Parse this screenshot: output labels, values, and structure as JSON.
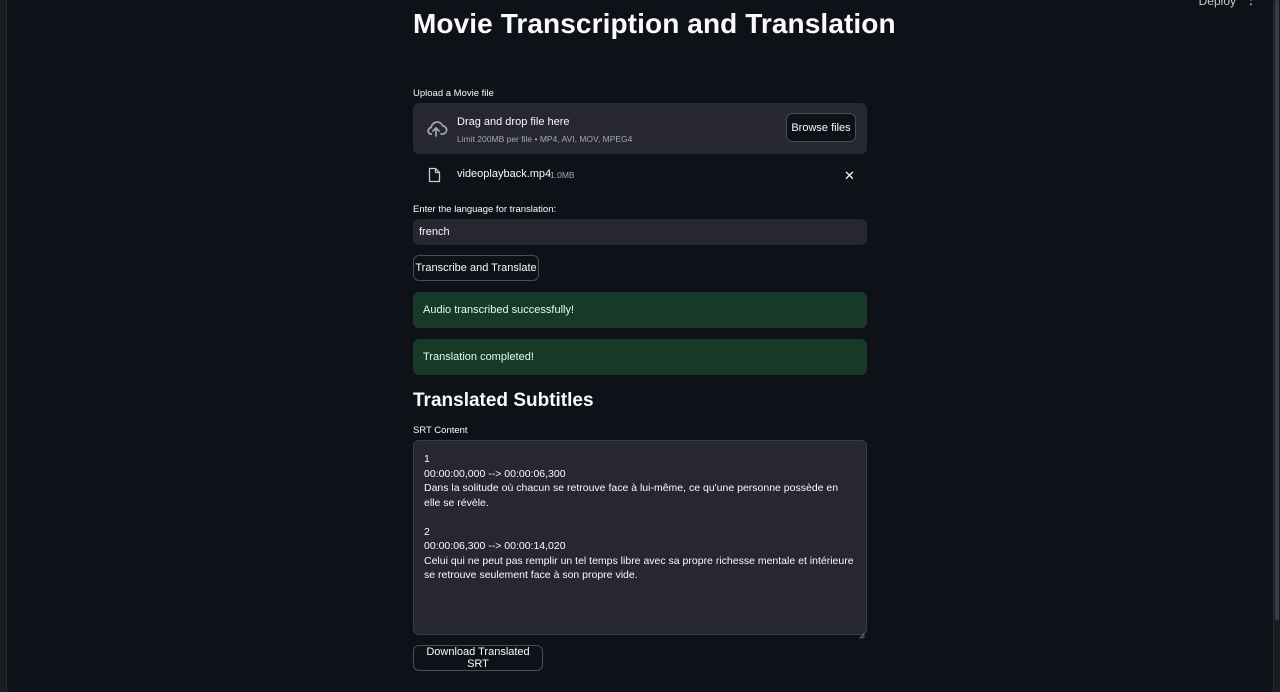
{
  "topbar": {
    "deploy_label": "Deploy",
    "menu_icon": "⋮"
  },
  "page": {
    "title": "Movie Transcription and Translation"
  },
  "upload": {
    "label": "Upload a Movie file",
    "dropzone_title": "Drag and drop file here",
    "dropzone_subtitle": "Limit 200MB per file • MP4, AVI, MOV, MPEG4",
    "browse_label": "Browse files",
    "icon": "cloud-upload-icon"
  },
  "uploaded_file": {
    "name": "videoplayback.mp4",
    "size": "1.0MB",
    "icon": "file-icon",
    "remove_glyph": "✕"
  },
  "language": {
    "label": "Enter the language for translation:",
    "value": "french"
  },
  "actions": {
    "transcribe_label": "Transcribe and Translate",
    "download_label": "Download Translated SRT"
  },
  "alerts": [
    "Audio transcribed successfully!",
    "Translation completed!"
  ],
  "subtitles": {
    "heading": "Translated Subtitles",
    "area_label": "SRT Content",
    "content": "1\n00:00:00,000 --> 00:00:06,300\nDans la solitude où chacun se retrouve face à lui-même, ce qu'une personne possède en elle se révèle.\n\n2\n00:00:06,300 --> 00:00:14,020\nCelui qui ne peut pas remplir un tel temps libre avec sa propre richesse mentale et intérieure se retrouve seulement face à son propre vide."
  },
  "colors": {
    "background": "#0e1117",
    "surface": "#262730",
    "success_bg": "#173928",
    "success_text": "#dffde9"
  }
}
